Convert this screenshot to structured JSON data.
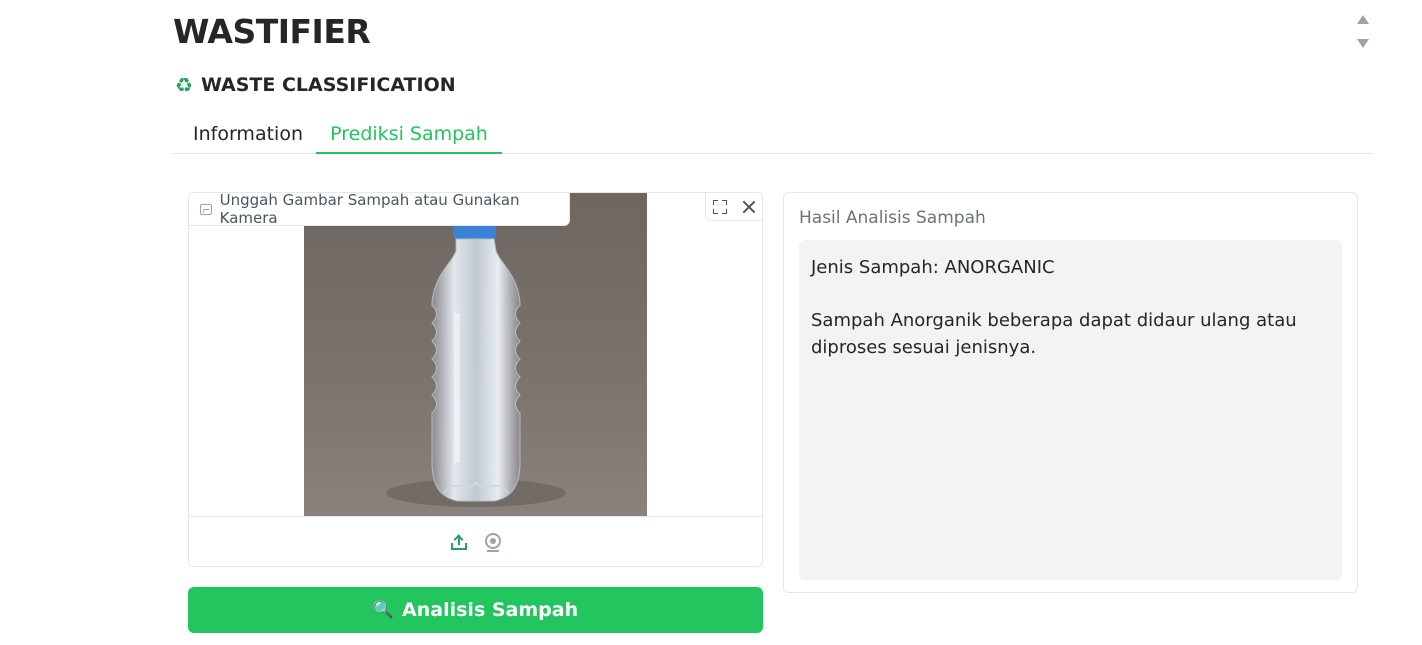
{
  "app": {
    "title": "WASTIFIER"
  },
  "section": {
    "icon": "recycle-icon",
    "title": "WASTE CLASSIFICATION"
  },
  "tabs": [
    {
      "label": "Information",
      "selected": false
    },
    {
      "label": "Prediksi Sampah",
      "selected": true
    }
  ],
  "upload": {
    "label": "Unggah Gambar Sampah atau Gunakan Kamera",
    "image_subject": "plastic-bottle",
    "tools": [
      "fullscreen-icon",
      "close-icon"
    ],
    "sources": [
      "upload-icon",
      "webcam-icon"
    ]
  },
  "analyze_button": {
    "icon": "magnifier-emoji",
    "icon_glyph": "🔍",
    "label": "Analisis Sampah"
  },
  "result": {
    "label": "Hasil Analisis Sampah",
    "line1": "Jenis Sampah: ANORGANIC",
    "line2": "Sampah Anorganik beberapa dapat didaur ulang atau diproses sesuai jenisnya."
  },
  "colors": {
    "accent": "#22c55e",
    "text": "#262626",
    "muted": "#6b7280",
    "result_bg": "#f3f3f3"
  }
}
